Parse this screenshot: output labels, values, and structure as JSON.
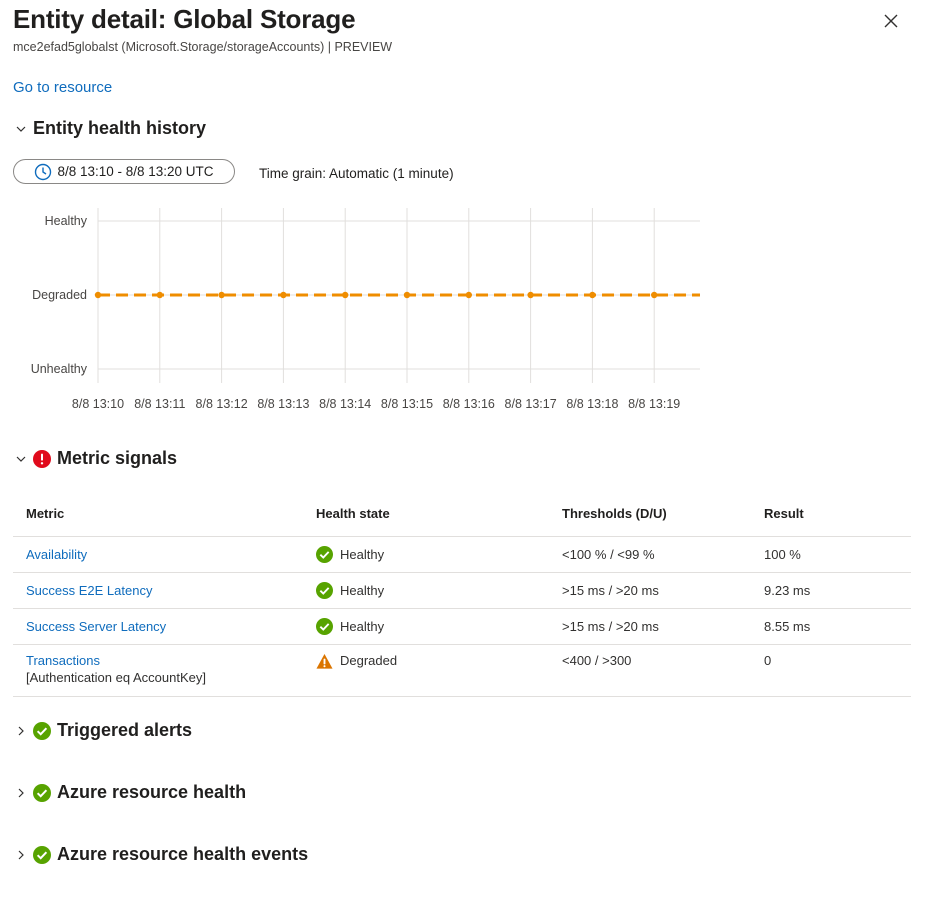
{
  "header": {
    "title": "Entity detail: Global Storage",
    "subtitle": "mce2efad5globalst (Microsoft.Storage/storageAccounts) | PREVIEW",
    "go_to_resource": "Go to resource"
  },
  "health_history": {
    "heading": "Entity health history",
    "time_range": "8/8 13:10 - 8/8 13:20 UTC",
    "time_grain": "Time grain: Automatic (1 minute)"
  },
  "chart_data": {
    "type": "line",
    "title": "",
    "xlabel": "",
    "ylabel": "",
    "y_categories": [
      "Unhealthy",
      "Degraded",
      "Healthy"
    ],
    "categories": [
      "8/8 13:10",
      "8/8 13:11",
      "8/8 13:12",
      "8/8 13:13",
      "8/8 13:14",
      "8/8 13:15",
      "8/8 13:16",
      "8/8 13:17",
      "8/8 13:18",
      "8/8 13:19"
    ],
    "series": [
      {
        "values": [
          "Degraded",
          "Degraded",
          "Degraded",
          "Degraded",
          "Degraded",
          "Degraded",
          "Degraded",
          "Degraded",
          "Degraded",
          "Degraded",
          "Degraded"
        ],
        "color": "#ef8d00",
        "style": "dashed"
      }
    ],
    "grid": true
  },
  "metric_signals": {
    "heading": "Metric signals",
    "status_icon": "error-icon",
    "columns": [
      "Metric",
      "Health state",
      "Thresholds (D/U)",
      "Result"
    ],
    "rows": [
      {
        "metric": "Availability",
        "metric_sub": "",
        "state": "Healthy",
        "state_icon": "success-icon",
        "thresholds": "<100 % / <99 %",
        "result": "100 %"
      },
      {
        "metric": "Success E2E Latency",
        "metric_sub": "",
        "state": "Healthy",
        "state_icon": "success-icon",
        "thresholds": ">15 ms / >20 ms",
        "result": "9.23 ms"
      },
      {
        "metric": "Success Server Latency",
        "metric_sub": "",
        "state": "Healthy",
        "state_icon": "success-icon",
        "thresholds": ">15 ms / >20 ms",
        "result": "8.55 ms"
      },
      {
        "metric": "Transactions",
        "metric_sub": "[Authentication eq AccountKey]",
        "state": "Degraded",
        "state_icon": "warning-icon",
        "thresholds": "<400 / >300",
        "result": "0"
      }
    ]
  },
  "sections": {
    "triggered_alerts": "Triggered alerts",
    "azure_resource_health": "Azure resource health",
    "azure_resource_health_events": "Azure resource health events"
  },
  "colors": {
    "link": "#0f6cbd",
    "healthy": "#57a300",
    "degraded": "#db7500",
    "error": "#e00b1c",
    "series": "#ef8d00"
  }
}
